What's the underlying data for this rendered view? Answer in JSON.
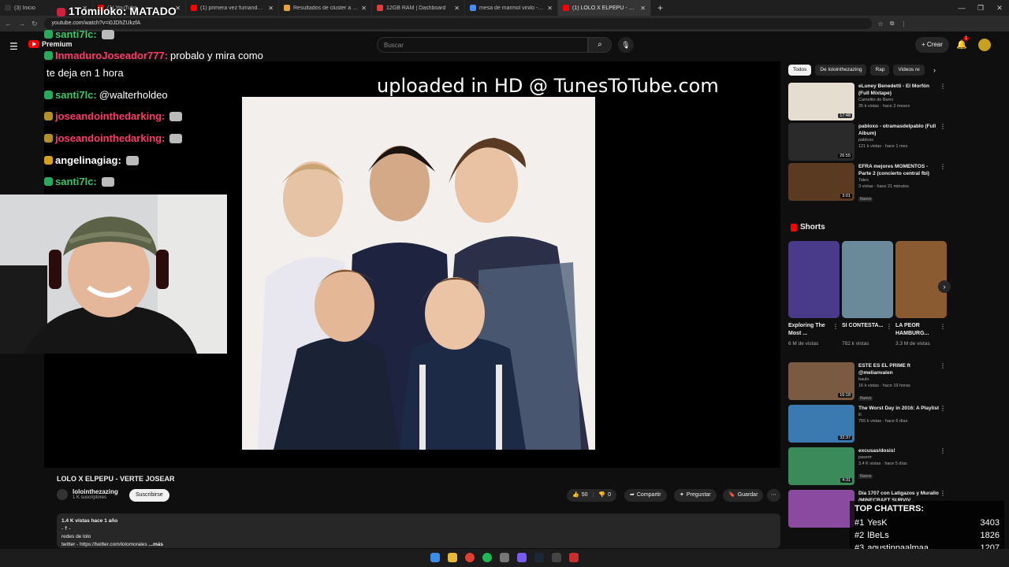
{
  "browser": {
    "tabs": [
      {
        "title": "(3) Inicio",
        "color": "#333333"
      },
      {
        "title": "(1) YouTube",
        "color": "#ff0000"
      },
      {
        "title": "(1) primera vez fumando porro",
        "color": "#ff0000"
      },
      {
        "title": "Resultados de cluster a z en Suc",
        "color": "#e8a33c"
      },
      {
        "title": "12GB RAM | Dashboard",
        "color": "#e23b3b"
      },
      {
        "title": "mesa de marmol vinilo - Buscar",
        "color": "#4a8af4"
      },
      {
        "title": "(1) LOLO X ELPEPU - VERTE",
        "color": "#ff0000"
      }
    ],
    "url": "youtube.com/watch?v=i0JDhZUkzfA"
  },
  "youtube": {
    "logo_label": "Premium",
    "search_placeholder": "Buscar",
    "create_label": "Crear",
    "notif_count": "1"
  },
  "stream_overlay": {
    "title": "1Tomiloko: MATADO",
    "chat": [
      {
        "user": "santi7lc:",
        "color_class": "u-green",
        "msg": ""
      },
      {
        "user": "InmaduroJoseador777:",
        "color_class": "u-red",
        "msg": "probalo y mira como"
      },
      {
        "user": "",
        "color_class": "u-white",
        "msg": "te deja en 1 hora"
      },
      {
        "user": "santi7lc:",
        "color_class": "u-green",
        "msg": "@walterholdeo"
      },
      {
        "user": "joseandointhedarking:",
        "color_class": "u-red",
        "msg": ""
      },
      {
        "user": "joseandointhedarking:",
        "color_class": "u-red",
        "msg": ""
      },
      {
        "user": "angelinagiag:",
        "color_class": "u-white",
        "msg": ""
      },
      {
        "user": "santi7lc:",
        "color_class": "u-green",
        "msg": ""
      }
    ],
    "top_chatters_title": "TOP CHATTERS:",
    "top_chatters": [
      {
        "rank": "#1",
        "name": "YesK",
        "count": "3403"
      },
      {
        "rank": "#2",
        "name": "lBeLs",
        "count": "1826"
      },
      {
        "rank": "#3",
        "name": "agustinpaalmaa",
        "count": "1207"
      }
    ]
  },
  "player": {
    "overlay_text": "uploaded in HD @ TunesToTube.com"
  },
  "video": {
    "title": "LOLO X ELPEPU - VERTE JOSEAR",
    "channel": "lolointhezazing",
    "subs": "1 K suscriptores",
    "subscribe": "Suscribirse",
    "likes": "50",
    "dislikes": "0",
    "share": "Compartir",
    "ask": "Preguntar",
    "save": "Guardar",
    "views_line": "1.4 K vistas  hace 1 año",
    "desc_line1": "- ☨ -",
    "desc_line2": "redes de lolo",
    "desc_line3": "twitter - https://twitter.com/lolomorales",
    "desc_more": "...más"
  },
  "sidebar": {
    "chips": [
      "Todos",
      "De lolointhezazing",
      "Rap",
      "Videos re"
    ],
    "recs": [
      {
        "title": "eLuney Benedetti - El Morfón (Full Mixtape)",
        "channel": "Camelito de Barro",
        "meta": "35 k vistas · hace 2 meses",
        "dur": "17:48",
        "new": "",
        "color": "#e5ddd0"
      },
      {
        "title": "pabloxo - otramasdelpablo (Full Album)",
        "channel": "pabloxo",
        "meta": "121 k vistas · hace 1 mes",
        "dur": "26:55",
        "new": "",
        "color": "#2a2a2a"
      },
      {
        "title": "EFRA mejores MOMENTOS - Parte 2 (concierto central fbi)",
        "channel": "Tales",
        "meta": "3 vistas · hace 21 minutos",
        "dur": "3:01",
        "new": "Nuevo",
        "color": "#5a3a20"
      }
    ],
    "shorts_header": "Shorts",
    "shorts": [
      {
        "title": "Exploring The Most ...",
        "views": "6 M de vistas",
        "color": "#4a3a8a"
      },
      {
        "title": "SI CONTESTA...",
        "views": "782 k vistas",
        "color": "#6a8a9a"
      },
      {
        "title": "LA PEOR HAMBURG...",
        "views": "3.3 M de vistas",
        "color": "#8a5a30"
      }
    ],
    "recs2": [
      {
        "title": "ESTE ES EL PRIME ft @melianvalen",
        "channel": "baulo",
        "meta": "16 k vistas · hace 19 horas",
        "dur": "16:18",
        "new": "Nuevo",
        "color": "#7a5a40"
      },
      {
        "title": "The Worst Day in 2016: A Playlist",
        "channel": "ili",
        "meta": "755 k vistas · hace 6 días",
        "dur": "32:37",
        "new": "",
        "color": "#3a7ab0"
      },
      {
        "title": "excusas/dosis!",
        "channel": "passrrr",
        "meta": "3.4 K vistas · hace 5 días",
        "dur": "4:31",
        "new": "Nuevo",
        "color": "#3a8a5a"
      },
      {
        "title": "Día 1707 con Latigazos y Murallo (MINECRAFT SURVIV...",
        "channel": "",
        "meta": "",
        "dur": "",
        "new": "",
        "color": "#8a4aa0"
      }
    ]
  }
}
